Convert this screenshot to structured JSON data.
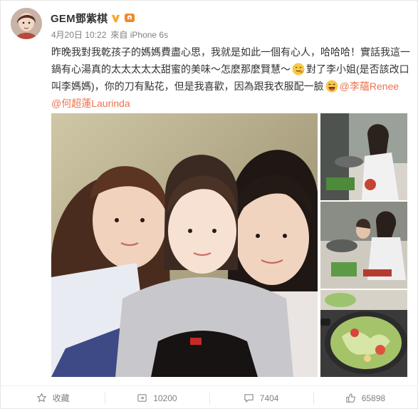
{
  "post": {
    "author": "GEM鄧紫棋",
    "time": "4月20日 10:22",
    "source": "來自 iPhone 6s",
    "text_line1_pre": "昨晚我對我乾孩子的媽媽費盡心思，我就是如此一個有心人，哈哈哈！實話我這一鍋有心湯真的太太太太太甜蜜的美味～怎麼那麼賢慧～",
    "text_line2_mid": "對了李小姐(是否該改口叫李媽媽)，你的刀有點花，但是我喜歡，因為跟我衣服配一臉",
    "mention_1": "@李蘊Renee",
    "mention_2": "@何超蓮Laurinda",
    "icons": {
      "vip": "verified-v-icon",
      "badge": "member-badge-icon",
      "favorite": "star-icon",
      "repost": "repost-icon",
      "comment": "comment-icon",
      "like": "thumbs-up-icon"
    }
  },
  "actions": {
    "favorite_label": "收藏",
    "repost_count": "10200",
    "comment_count": "7404",
    "like_count": "65898"
  },
  "colors": {
    "link": "#eb7350",
    "text": "#333333",
    "meta": "#808080"
  }
}
